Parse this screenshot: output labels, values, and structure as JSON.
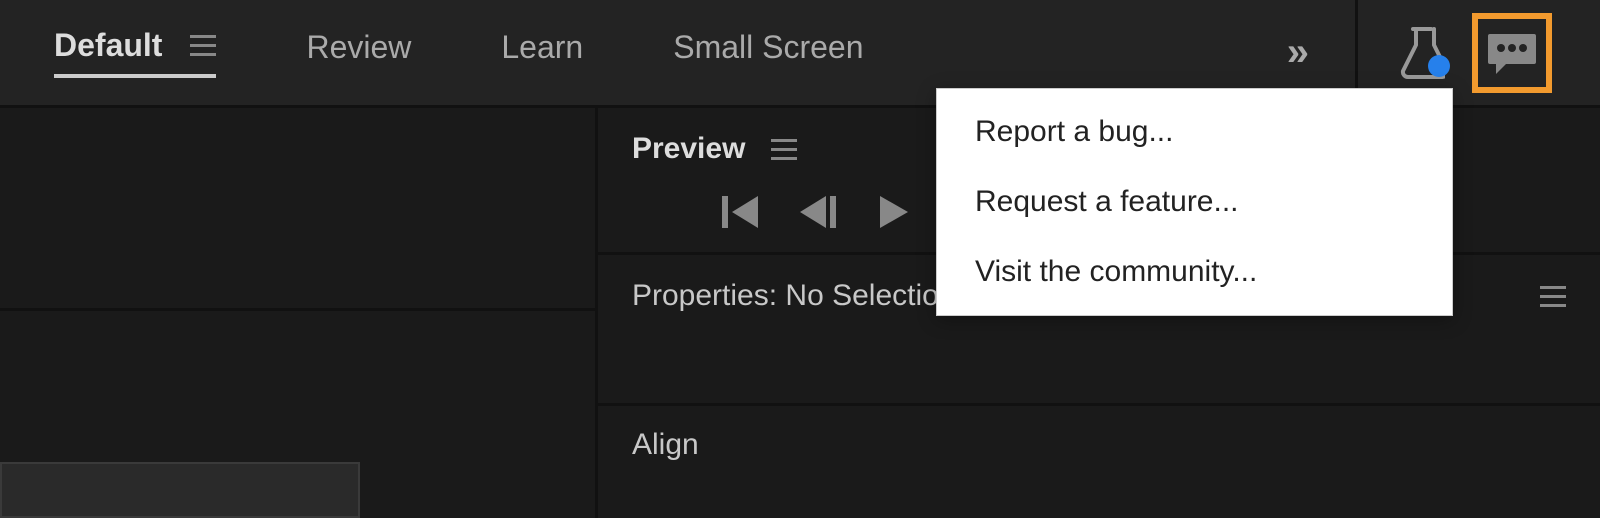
{
  "workspace": {
    "tabs": [
      {
        "label": "Default",
        "active": true,
        "has_menu": true
      },
      {
        "label": "Review",
        "active": false,
        "has_menu": false
      },
      {
        "label": "Learn",
        "active": false,
        "has_menu": false
      },
      {
        "label": "Small Screen",
        "active": false,
        "has_menu": false
      }
    ]
  },
  "preview": {
    "title": "Preview"
  },
  "properties": {
    "title": "Properties: No Selection"
  },
  "align": {
    "title": "Align"
  },
  "feedback_menu": {
    "items": [
      "Report a bug...",
      "Request a feature...",
      "Visit the community..."
    ]
  }
}
